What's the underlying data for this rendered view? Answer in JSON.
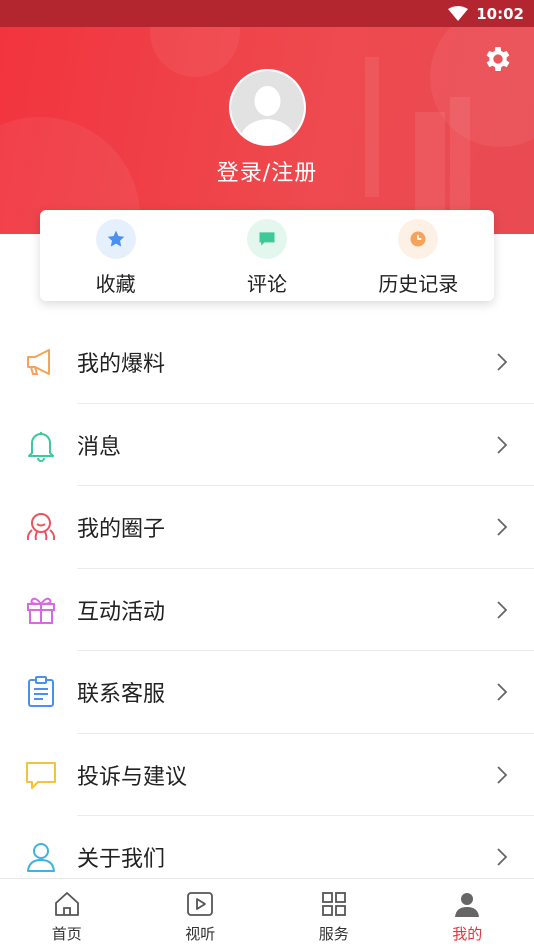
{
  "status_bar": {
    "time": "10:02"
  },
  "profile": {
    "login_label": "登录/注册"
  },
  "quick_actions": [
    {
      "label": "收藏",
      "icon": "star-icon",
      "color": "#4a90f0"
    },
    {
      "label": "评论",
      "icon": "comment-icon",
      "color": "#3ec99a"
    },
    {
      "label": "历史记录",
      "icon": "clock-icon",
      "color": "#f5a25a"
    }
  ],
  "menu": [
    {
      "label": "我的爆料",
      "icon": "megaphone-icon",
      "color": "#f5a25a"
    },
    {
      "label": "消息",
      "icon": "bell-icon",
      "color": "#3ec99a"
    },
    {
      "label": "我的圈子",
      "icon": "circle-group-icon",
      "color": "#e8555f"
    },
    {
      "label": "互动活动",
      "icon": "gift-icon",
      "color": "#d46be0"
    },
    {
      "label": "联系客服",
      "icon": "clipboard-icon",
      "color": "#4a90f0"
    },
    {
      "label": "投诉与建议",
      "icon": "chat-bubble-icon",
      "color": "#f2c33b"
    },
    {
      "label": "关于我们",
      "icon": "person-icon",
      "color": "#3eb2e0"
    }
  ],
  "tabs": [
    {
      "label": "首页",
      "icon": "home-icon",
      "active": false
    },
    {
      "label": "视听",
      "icon": "play-icon",
      "active": false
    },
    {
      "label": "服务",
      "icon": "grid-icon",
      "active": false
    },
    {
      "label": "我的",
      "icon": "user-icon",
      "active": true
    }
  ],
  "colors": {
    "brand": "#e8343e",
    "status_bar": "#b3252f"
  }
}
